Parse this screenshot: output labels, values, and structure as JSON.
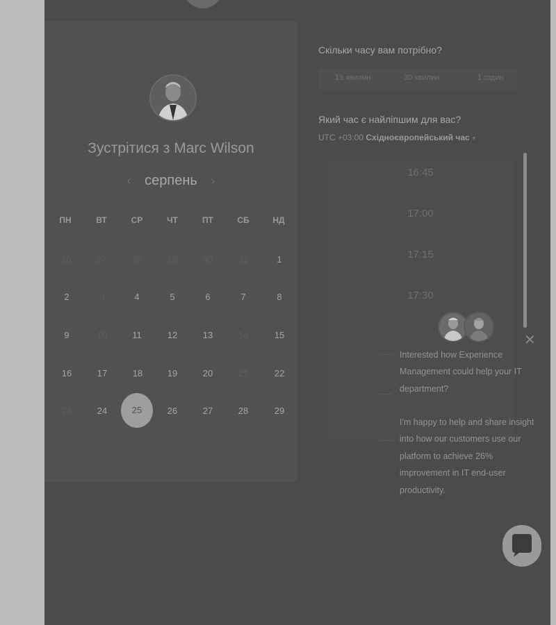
{
  "calendar": {
    "title": "Зустрітися з Marc Wilson",
    "month": "серпень",
    "prev_arrow": "‹",
    "next_arrow": "›",
    "weekdays": [
      "ПН",
      "ВТ",
      "СР",
      "ЧТ",
      "ПТ",
      "СБ",
      "НД"
    ],
    "weeks": [
      [
        "26",
        "27",
        "28",
        "29",
        "30",
        "31",
        "1"
      ],
      [
        "2",
        "3",
        "4",
        "5",
        "6",
        "7",
        "8"
      ],
      [
        "9",
        "10",
        "11",
        "12",
        "13",
        "14",
        "15"
      ],
      [
        "16",
        "17",
        "18",
        "19",
        "20",
        "21",
        "22"
      ],
      [
        "23",
        "24",
        "25",
        "26",
        "27",
        "28",
        "29"
      ]
    ],
    "selected_day": "25"
  },
  "booking": {
    "duration_question": "Скільки часу вам потрібно?",
    "durations": [
      "15 хвилин",
      "30 хвилин",
      "1 годин"
    ],
    "time_question": "Який час є найліпшим для вас?",
    "timezone_offset": "UTC +03:00",
    "timezone_name": "Східноєвропейський час",
    "caret": "▾",
    "slots": [
      "16:45",
      "17:00",
      "17:15",
      "17:30"
    ]
  },
  "chat": {
    "close": "✕",
    "message_1": "Interested how Experience Management could help your IT department?",
    "message_2": "I'm happy to help and share insight into how our customers use our platform to achieve 26% improvement in IT end-user productivity."
  }
}
